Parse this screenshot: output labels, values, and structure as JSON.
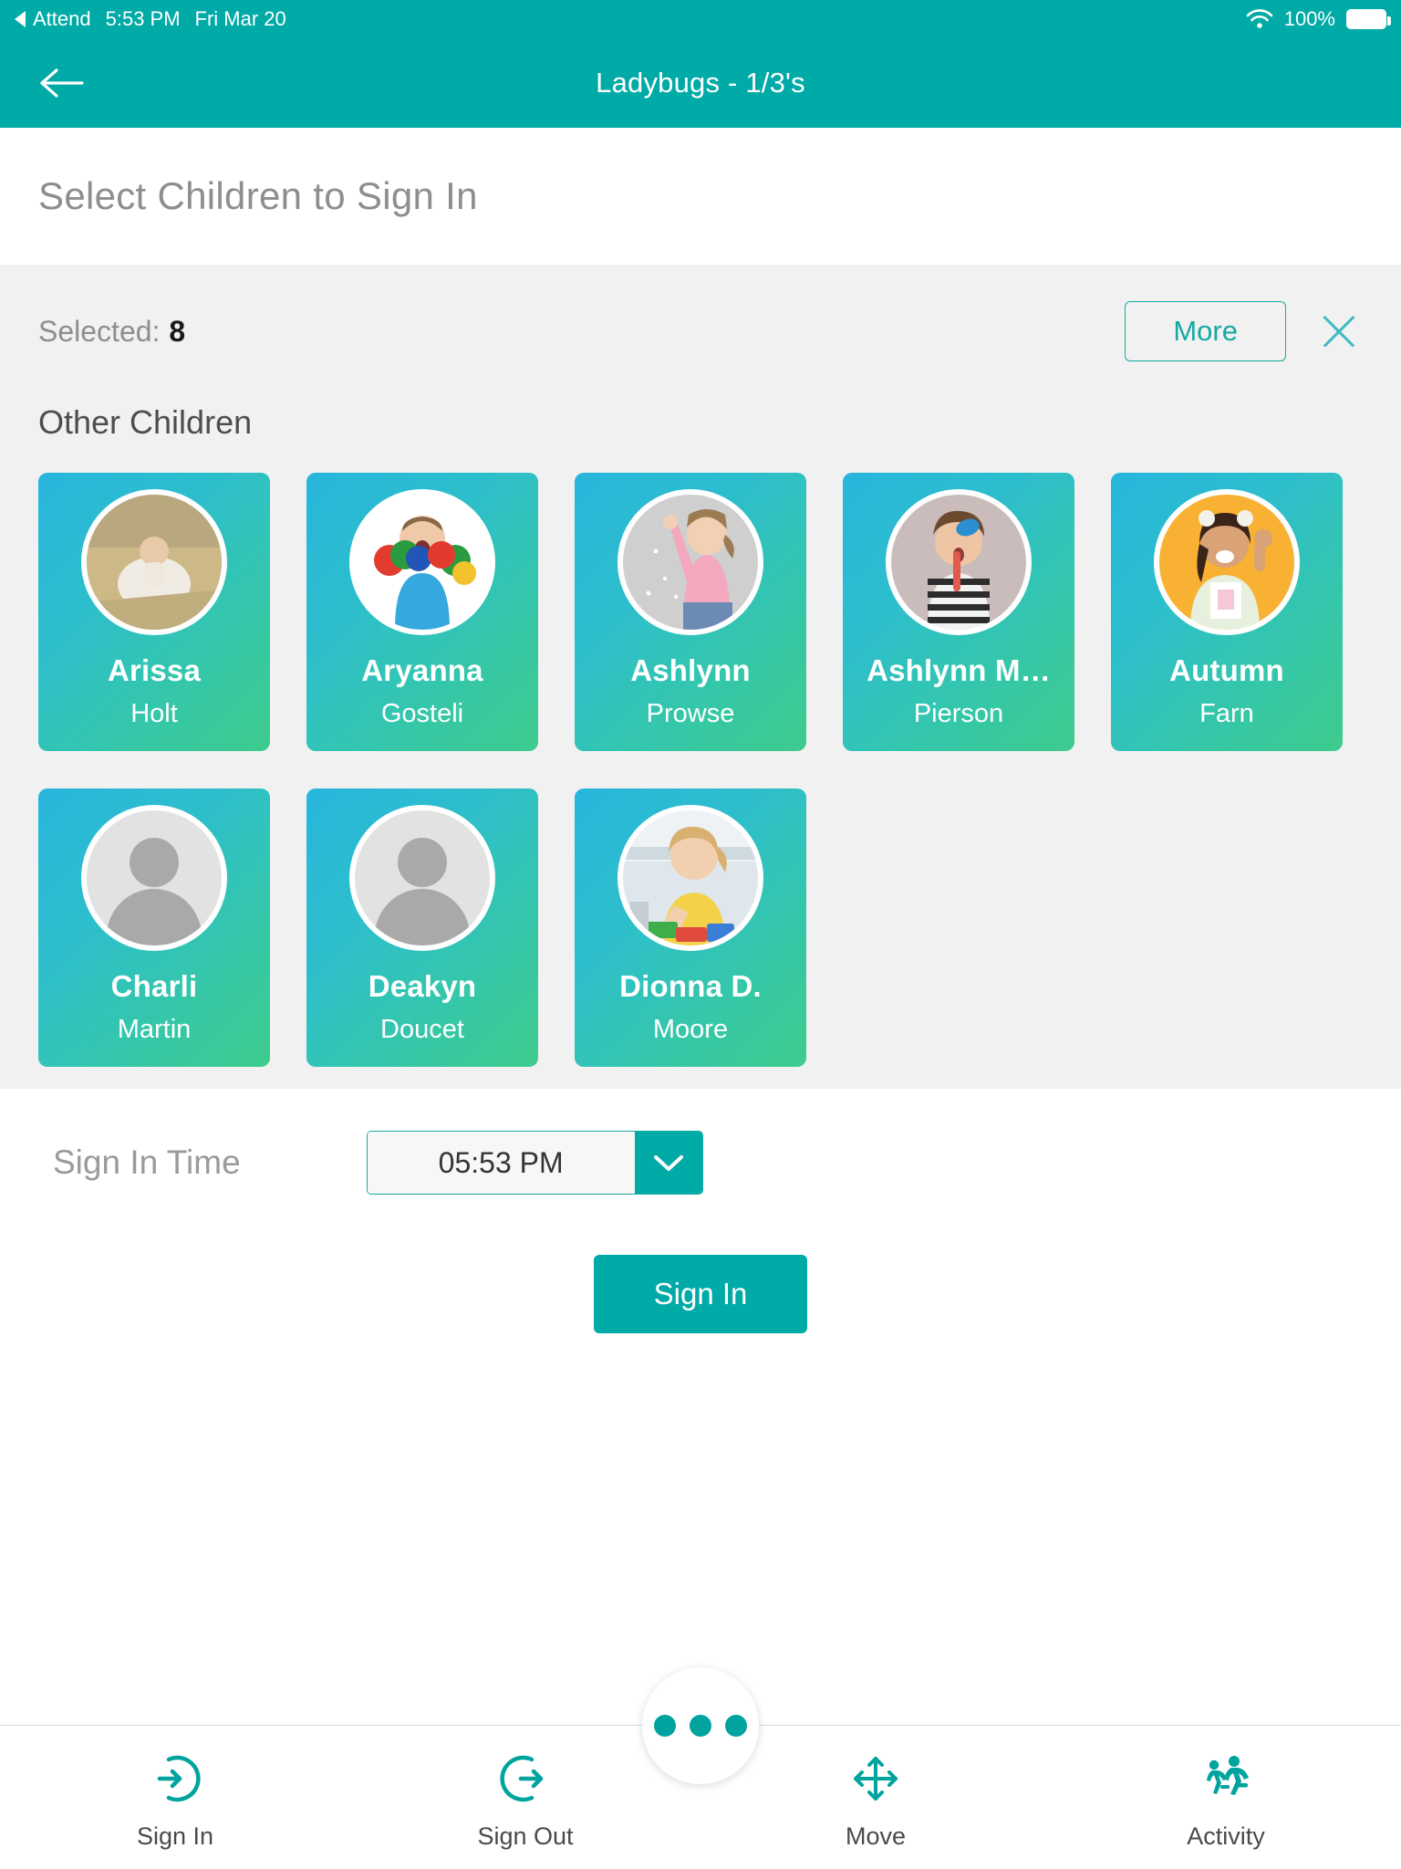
{
  "statusbar": {
    "back_app": "Attend",
    "back_icon": "triangle-left-icon",
    "time": "5:53 PM",
    "date": "Fri Mar 20",
    "wifi_icon": "wifi-icon",
    "battery_percent": "100%",
    "battery_icon": "battery-full-icon"
  },
  "navbar": {
    "back_icon": "arrow-left-icon",
    "title": "Ladybugs - 1/3's"
  },
  "page": {
    "heading": "Select Children to Sign In"
  },
  "selection": {
    "selected_label": "Selected:",
    "selected_count": "8",
    "more_label": "More",
    "close_icon": "close-icon",
    "group_title": "Other Children"
  },
  "children": [
    {
      "first": "Arissa",
      "last": "Holt",
      "avatar": "photo",
      "photo_bg": "#c8b municipality"
    },
    {
      "first": "Aryanna",
      "last": "Gosteli",
      "avatar": "photo",
      "photo_bg": "#ffffff"
    },
    {
      "first": "Ashlynn",
      "last": "Prowse",
      "avatar": "photo",
      "photo_bg": "#cfcfcf"
    },
    {
      "first": "Ashlynn M…",
      "last": "Pierson",
      "avatar": "photo",
      "photo_bg": "#c9bcbb"
    },
    {
      "first": "Autumn",
      "last": "Farn",
      "avatar": "photo",
      "photo_bg": "#f8b133"
    },
    {
      "first": "Charli",
      "last": "Martin",
      "avatar": "placeholder",
      "photo_bg": "#e2e2e2"
    },
    {
      "first": "Deakyn",
      "last": "Doucet",
      "avatar": "placeholder",
      "photo_bg": "#e2e2e2"
    },
    {
      "first": "Dionna D.",
      "last": "Moore",
      "avatar": "photo",
      "photo_bg": "#dfe6ec"
    }
  ],
  "time_row": {
    "label": "Sign In Time",
    "value": "05:53 PM",
    "chevron_icon": "chevron-down-icon"
  },
  "primary_action": {
    "label": "Sign In"
  },
  "tabbar": {
    "fab_icon": "more-dots-icon",
    "tabs": [
      {
        "label": "Sign In",
        "icon": "sign-in-icon"
      },
      {
        "label": "Sign Out",
        "icon": "sign-out-icon"
      },
      {
        "label": "Move",
        "icon": "move-arrows-icon"
      },
      {
        "label": "Activity",
        "icon": "running-people-icon"
      }
    ]
  },
  "colors": {
    "brand_teal": "#00aaa6",
    "panel_grey": "#f1f1f1",
    "card_gradient_start": "#27b6dc",
    "card_gradient_end": "#3ecb8c"
  }
}
